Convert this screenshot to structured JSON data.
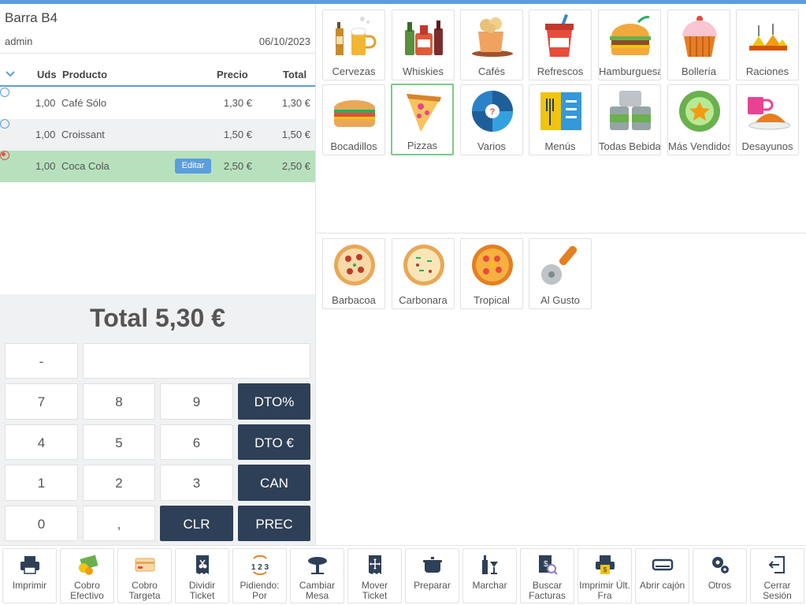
{
  "header": {
    "title": "Barra B4",
    "user": "admin",
    "date": "06/10/2023"
  },
  "ticket": {
    "columns": {
      "uds": "Uds",
      "producto": "Producto",
      "precio": "Precio",
      "total": "Total"
    },
    "rows": [
      {
        "uds": "1,00",
        "producto": "Café Sólo",
        "precio": "1,30 €",
        "total": "1,30 €",
        "selected": false
      },
      {
        "uds": "1,00",
        "producto": "Croissant",
        "precio": "1,50 €",
        "total": "1,50 €",
        "selected": false
      },
      {
        "uds": "1,00",
        "producto": "Coca Cola",
        "precio": "2,50 €",
        "total": "2,50 €",
        "selected": true
      }
    ],
    "edit_label": "Editar"
  },
  "total_label": "Total 5,30 €",
  "keypad": {
    "minus": "-",
    "k7": "7",
    "k8": "8",
    "k9": "9",
    "k4": "4",
    "k5": "5",
    "k6": "6",
    "k1": "1",
    "k2": "2",
    "k3": "3",
    "k0": "0",
    "comma": ",",
    "dto_pct": "DTO%",
    "dto_eur": "DTO €",
    "can": "CAN",
    "clr": "CLR",
    "prec": "PREC"
  },
  "categories": [
    {
      "label": "Cervezas",
      "icon": "beer-icon"
    },
    {
      "label": "Whiskies",
      "icon": "whisky-icon"
    },
    {
      "label": "Cafés",
      "icon": "coffee-icon"
    },
    {
      "label": "Refrescos",
      "icon": "soda-icon"
    },
    {
      "label": "Hamburguesas",
      "icon": "burger-icon"
    },
    {
      "label": "Bollería",
      "icon": "cupcake-icon"
    },
    {
      "label": "Raciones",
      "icon": "cheese-icon"
    },
    {
      "label": "Bocadillos",
      "icon": "sandwich-icon"
    },
    {
      "label": "Pizzas",
      "icon": "pizza-slice-icon"
    },
    {
      "label": "Varios",
      "icon": "wheel-icon"
    },
    {
      "label": "Menús",
      "icon": "menu-icon"
    },
    {
      "label": "Todas Bebidas",
      "icon": "cans-icon"
    },
    {
      "label": "Más Vendidos",
      "icon": "star-badge-icon"
    },
    {
      "label": "Desayunos",
      "icon": "breakfast-icon"
    }
  ],
  "products": [
    {
      "label": "Barbacoa",
      "icon": "pizza-icon"
    },
    {
      "label": "Carbonara",
      "icon": "pizza-icon"
    },
    {
      "label": "Tropical",
      "icon": "pizza-icon"
    },
    {
      "label": "Al Gusto",
      "icon": "pizza-cutter-icon"
    }
  ],
  "toolbar": [
    {
      "label": "Imprimir",
      "icon": "printer-icon"
    },
    {
      "label": "Cobro Efectivo",
      "icon": "cash-icon"
    },
    {
      "label": "Cobro Targeta",
      "icon": "card-icon"
    },
    {
      "label": "Dividir Ticket",
      "icon": "split-ticket-icon"
    },
    {
      "label": "Pidiendo: Por",
      "icon": "order-123-icon"
    },
    {
      "label": "Cambiar Mesa",
      "icon": "table-icon"
    },
    {
      "label": "Mover Ticket",
      "icon": "move-ticket-icon"
    },
    {
      "label": "Preparar",
      "icon": "pot-icon"
    },
    {
      "label": "Marchar",
      "icon": "bottle-glass-icon"
    },
    {
      "label": "Buscar Facturas",
      "icon": "search-invoice-icon"
    },
    {
      "label": "Imprimir Últ. Fra",
      "icon": "print-invoice-icon"
    },
    {
      "label": "Abrir cajón",
      "icon": "drawer-icon"
    },
    {
      "label": "Otros",
      "icon": "gears-icon"
    },
    {
      "label": "Cerrar Sesión",
      "icon": "logout-icon"
    }
  ],
  "colors": {
    "accent": "#5b9ede",
    "dark_key": "#2e4057",
    "selected_row": "#b7e1bd",
    "active_tile": "#7cc98a"
  }
}
